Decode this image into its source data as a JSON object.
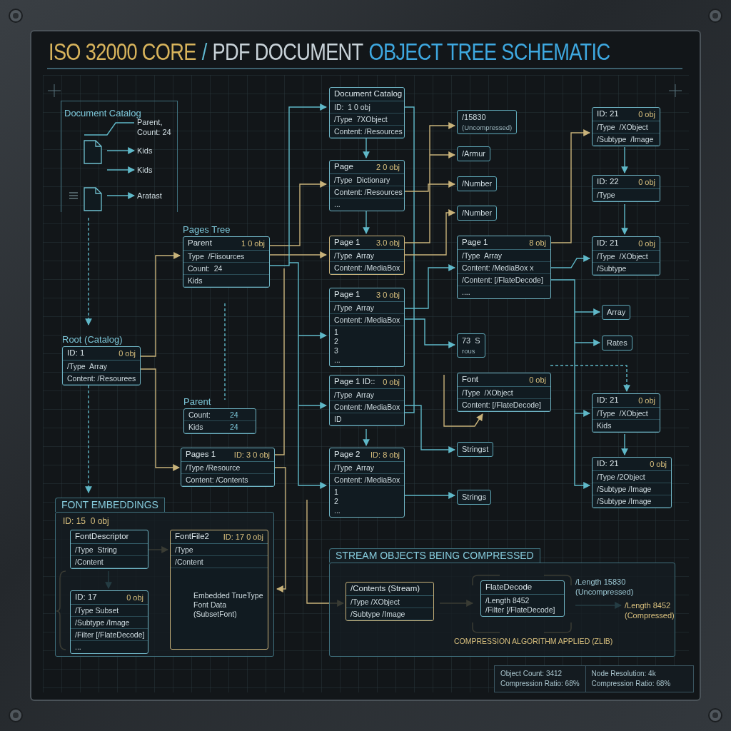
{
  "title": [
    {
      "text": "ISO 32000 CORE",
      "color": "#d8b45c"
    },
    {
      "text": "/",
      "color": "#5fb8d0"
    },
    {
      "text": "PDF DOCUMENT",
      "color": "#c8d2d8"
    },
    {
      "text": "OBJECT TREE SCHEMATIC",
      "color": "#3ea8e0"
    }
  ],
  "catalog_panel": {
    "title": "Document Catalog",
    "labels": [
      "Parent, Count: 24",
      "Kids",
      "Kids",
      "Aratast"
    ]
  },
  "nodes": [
    {
      "label": "Pages Tree",
      "title": "Parent",
      "ref": "1 0 obj",
      "rows": [
        "Type  /Flisources",
        "Count:  24",
        "Kids"
      ],
      "color": "#6fb4c4"
    },
    {
      "label": "Root (Catalog)",
      "title": "ID: 1",
      "ref": "0 obj",
      "rows": [
        "/Type  Array",
        "Content: /Resourees"
      ],
      "color": "#6fb4c4"
    },
    {
      "label": "Parent",
      "rows": [
        {
          "label": "Count:",
          "value": "24"
        },
        {
          "label": "Kids",
          "value": "24"
        }
      ],
      "color": "#6fb4c4"
    },
    {
      "title": "Pages 1",
      "ref": "ID: 3 0 obj",
      "rows": [
        "/Type /Resource",
        "Content: /Contents"
      ],
      "color": "#6fb4c4"
    },
    {
      "title": "Document Catalog",
      "rows": [
        "ID:  1 0 obj",
        "/Type  7XObject",
        "Content: /Resources"
      ],
      "color": "#6fb4c4"
    },
    {
      "title": "Page",
      "ref": "2 0 obj",
      "rows": [
        "/Type  Dictionary",
        "Content: /Resources"
      ],
      "lines": [
        "..."
      ],
      "color": "#6fb4c4"
    },
    {
      "title": "Page 1",
      "ref": "3.0 obj",
      "rows": [
        "/Type  Array",
        "Content: /MediaBox"
      ],
      "color": "#c8b27a"
    },
    {
      "title": "Page 1",
      "ref": "3 0 obj",
      "rows": [
        "/Type  Array",
        "Content: /MediaBox"
      ],
      "lines": [
        "1",
        "2",
        "3",
        "..."
      ],
      "color": "#6fb4c4"
    },
    {
      "title": "Page 1 ID::",
      "ref": "0 obj",
      "rows": [
        "/Type  Array",
        "Content: /MediaBox",
        "ID"
      ],
      "color": "#6fb4c4"
    },
    {
      "title": "Page 2",
      "ref": "ID: 8 obj",
      "rows": [
        "/Type  Array",
        "Content: /MediaBox"
      ],
      "lines": [
        "1",
        "2",
        "..."
      ],
      "color": "#6fb4c4"
    },
    {
      "title": "Page 1",
      "ref": "8 obj",
      "rows": [
        "/Type  Array",
        "Content: /MediaBox x",
        "/Content: [/FlateDecode]"
      ],
      "lines": [
        "...."
      ],
      "color": "#6fb4c4"
    },
    {
      "title": "Font",
      "ref": "0 obj",
      "rows": [
        "/Type  /XObject",
        "Content: [/FlateDecode]"
      ],
      "color": "#6fb4c4"
    },
    {
      "title": "ID: 21",
      "ref": "0 obj",
      "rows": [
        "/Type  /XObject",
        "/Subtype  /Image"
      ],
      "color": "#6fb4c4"
    },
    {
      "title": "ID: 22",
      "ref": "0 obj",
      "rows": [
        "/Type"
      ],
      "color": "#6fb4c4"
    },
    {
      "title": "ID: 21",
      "ref": "0 obj",
      "rows": [
        "/Type  /XObject",
        "/Subtype"
      ],
      "color": "#6fb4c4"
    },
    {
      "title": "ID: 21",
      "ref": "0 obj",
      "rows": [
        "/Type  /XObject",
        "Kids"
      ],
      "color": "#6fb4c4"
    },
    {
      "title": "ID: 21",
      "ref": "0 obj",
      "rows": [
        "/Type /2Object",
        "/Subtype /Image",
        "/Subtype /Image"
      ],
      "color": "#6fb4c4"
    }
  ],
  "tags": [
    {
      "lines": [
        "/15830",
        "(Uncompressed)"
      ]
    },
    {
      "lines": [
        "/Armur"
      ]
    },
    {
      "lines": [
        "/Number"
      ]
    },
    {
      "lines": [
        "/Number"
      ]
    },
    {
      "lines": [
        "73  S",
        "rous"
      ]
    },
    {
      "lines": [
        "Stringst"
      ]
    },
    {
      "lines": [
        "Strings"
      ]
    },
    {
      "lines": [
        "Array"
      ]
    },
    {
      "lines": [
        "Rates"
      ]
    }
  ],
  "font_embeddings": {
    "title": "FONT EMBEDDINGS",
    "id": "ID: 15  0 obj",
    "nodes": [
      {
        "title": "FontDescriptor",
        "rows": [
          "/Type  String",
          "/Content"
        ],
        "color": "#6fb4c4"
      },
      {
        "title": "FontFile2",
        "ref": "ID: 17  0 obj",
        "rows": [
          "/Type",
          "/Content"
        ],
        "lines": [
          "Embedded TrueType",
          "Font Data",
          "(SubsetFont)"
        ],
        "color": "#c8b27a"
      },
      {
        "title": "ID: 17",
        "ref": "0 obj",
        "rows": [
          "/Type Subset",
          "/Subtype /Image",
          "/Filter [/FlateDecode]"
        ],
        "lines": [
          "..."
        ],
        "color": "#6fb4c4"
      }
    ]
  },
  "stream_panel": {
    "title": "STREAM OBJECTS BEING COMPRESSED",
    "nodes": [
      {
        "title": "/Contents (Stream)",
        "rows": [
          "/Type /XObject",
          "/Subtype /Image"
        ],
        "color": "#c8b27a"
      },
      {
        "title": "FlateDecode",
        "lines": [
          "/Length 8452",
          "/Filter [/FlateDecode]"
        ],
        "color": "#6fb4c4"
      }
    ],
    "uncompressed": [
      "/Length 15830",
      "(Uncompressed)"
    ],
    "compressed": [
      "/Length 8452",
      "(Compressed)"
    ],
    "caption": "COMPRESSION ALGORITHM APPLIED (ZLIB)"
  },
  "stats": [
    [
      "Object Count: 3412",
      "Compression Ratio: 68%"
    ],
    [
      "Node Resolution: 4k",
      "Compression Ratio: 68%"
    ]
  ]
}
